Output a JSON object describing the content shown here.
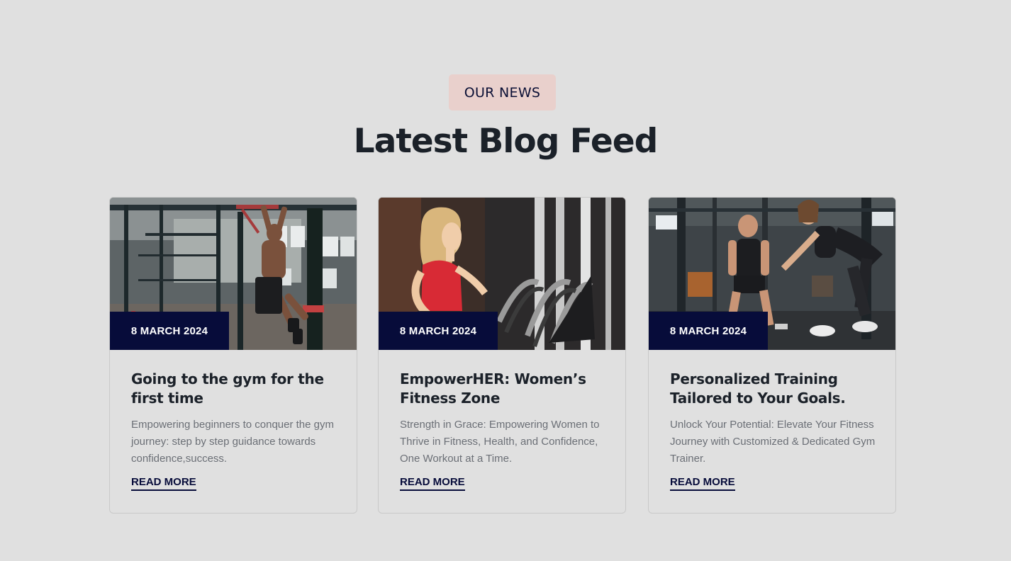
{
  "section": {
    "badge": "OUR NEWS",
    "title": "Latest Blog Feed"
  },
  "posts": [
    {
      "date": "8 MARCH 2024",
      "title": "Going to the gym for the first time",
      "excerpt": "Empowering beginners to conquer the gym journey: step by step guidance towards confidence,success.",
      "read_more": "READ MORE",
      "image": "man-doing-pull-ups-in-gym"
    },
    {
      "date": "8 MARCH 2024",
      "title": "EmpowerHER: Women’s Fitness Zone",
      "excerpt": "Strength in Grace: Empowering Women to Thrive in Fitness, Health, and Confidence, One Workout at a Time.",
      "read_more": "READ MORE",
      "image": "woman-running-on-treadmill"
    },
    {
      "date": "8 MARCH 2024",
      "title": "Personalized Training Tailored to Your Goals.",
      "excerpt": "Unlock Your Potential: Elevate Your Fitness Journey with Customized & Dedicated Gym Trainer.",
      "read_more": "READ MORE",
      "image": "trainer-with-client-in-gym"
    }
  ],
  "colors": {
    "background": "#e0e0e0",
    "badge_bg": "#e9d0cc",
    "navy": "#070c3a",
    "heading": "#1b2129",
    "body_text": "#6b6f76"
  }
}
